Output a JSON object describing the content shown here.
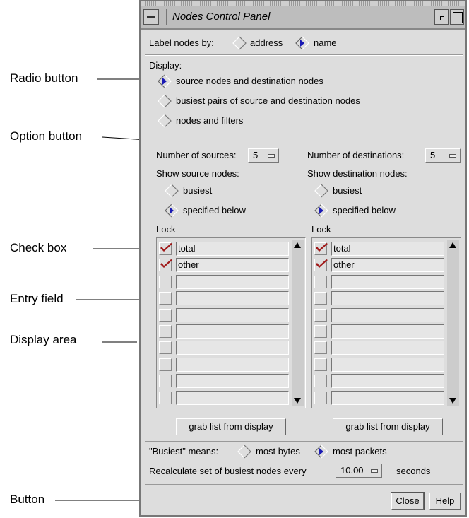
{
  "callouts": {
    "radio_button": "Radio button",
    "option_button": "Option button",
    "check_box": "Check box",
    "entry_field": "Entry field",
    "display_area": "Display area",
    "button": "Button"
  },
  "window": {
    "title": "Nodes Control Panel"
  },
  "label_nodes": {
    "label": "Label nodes by:",
    "options": [
      {
        "label": "address",
        "selected": false
      },
      {
        "label": "name",
        "selected": true
      }
    ]
  },
  "display": {
    "label": "Display:",
    "options": [
      {
        "label": "source nodes and destination nodes",
        "selected": true
      },
      {
        "label": "busiest pairs of source and destination nodes",
        "selected": false
      },
      {
        "label": "nodes and filters",
        "selected": false
      }
    ]
  },
  "source": {
    "count_label": "Number of sources:",
    "count_value": "5",
    "show_label": "Show source nodes:",
    "options": [
      {
        "label": "busiest",
        "selected": false
      },
      {
        "label": "specified below",
        "selected": true
      }
    ],
    "lock_label": "Lock",
    "rows": [
      {
        "checked": true,
        "value": "total"
      },
      {
        "checked": true,
        "value": "other"
      },
      {
        "checked": false,
        "value": ""
      },
      {
        "checked": false,
        "value": ""
      },
      {
        "checked": false,
        "value": ""
      },
      {
        "checked": false,
        "value": ""
      },
      {
        "checked": false,
        "value": ""
      },
      {
        "checked": false,
        "value": ""
      },
      {
        "checked": false,
        "value": ""
      },
      {
        "checked": false,
        "value": ""
      }
    ],
    "grab_button": "grab list from display"
  },
  "destination": {
    "count_label": "Number of destinations:",
    "count_value": "5",
    "show_label": "Show destination nodes:",
    "options": [
      {
        "label": "busiest",
        "selected": false
      },
      {
        "label": "specified below",
        "selected": true
      }
    ],
    "lock_label": "Lock",
    "rows": [
      {
        "checked": true,
        "value": "total"
      },
      {
        "checked": true,
        "value": "other"
      },
      {
        "checked": false,
        "value": ""
      },
      {
        "checked": false,
        "value": ""
      },
      {
        "checked": false,
        "value": ""
      },
      {
        "checked": false,
        "value": ""
      },
      {
        "checked": false,
        "value": ""
      },
      {
        "checked": false,
        "value": ""
      },
      {
        "checked": false,
        "value": ""
      },
      {
        "checked": false,
        "value": ""
      }
    ],
    "grab_button": "grab list from display"
  },
  "busiest": {
    "label": "\"Busiest\" means:",
    "options": [
      {
        "label": "most bytes",
        "selected": false
      },
      {
        "label": "most packets",
        "selected": true
      }
    ]
  },
  "recalc": {
    "label": "Recalculate set of busiest nodes every",
    "value": "10.00",
    "unit": "seconds"
  },
  "buttons": {
    "close": "Close",
    "help": "Help"
  },
  "colors": {
    "check": "#a01818",
    "radio_fill": "#1a1ab4",
    "window_bg": "#dddddd"
  }
}
